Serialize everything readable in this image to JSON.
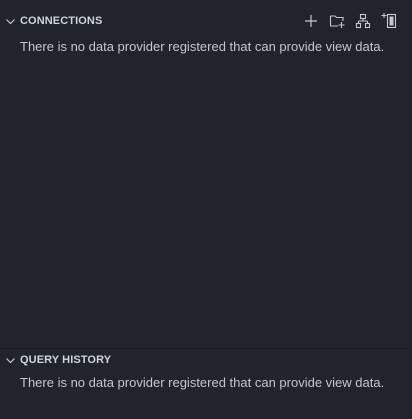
{
  "connections": {
    "title": "CONNECTIONS",
    "message": "There is no data provider registered that can provide view data.",
    "actions": [
      {
        "icon": "plus-icon"
      },
      {
        "icon": "new-folder-icon"
      },
      {
        "icon": "server-group-icon"
      },
      {
        "icon": "new-query-icon"
      }
    ]
  },
  "query_history": {
    "title": "QUERY HISTORY",
    "message": "There is no data provider registered that can provide view data."
  },
  "colors": {
    "background": "#21252b",
    "header_text": "#cfd3da",
    "body_text": "#c2c6cc"
  }
}
